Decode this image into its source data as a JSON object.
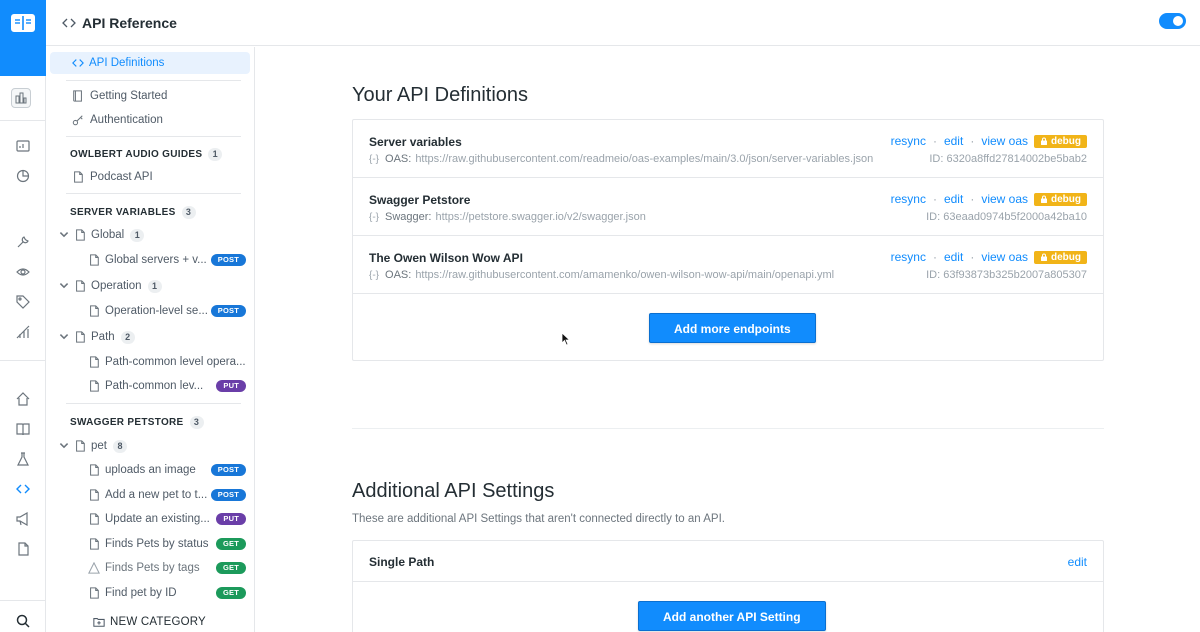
{
  "header": {
    "title": "API Reference"
  },
  "sidebar": {
    "active_item": "API Definitions",
    "top_items": [
      "Getting Started",
      "Authentication"
    ],
    "sections": [
      {
        "title": "OWLBERT AUDIO GUIDES",
        "count": "1",
        "items": [
          {
            "label": "Podcast API"
          }
        ]
      },
      {
        "title": "SERVER VARIABLES",
        "count": "3",
        "groups": [
          {
            "label": "Global",
            "count": "1",
            "pages": [
              {
                "label": "Global servers + v...",
                "method": "POST"
              }
            ]
          },
          {
            "label": "Operation",
            "count": "1",
            "pages": [
              {
                "label": "Operation-level se...",
                "method": "POST"
              }
            ]
          },
          {
            "label": "Path",
            "count": "2",
            "pages": [
              {
                "label": "Path-common level opera...",
                "method": ""
              },
              {
                "label": "Path-common lev...",
                "method": "PUT"
              }
            ]
          }
        ]
      },
      {
        "title": "SWAGGER PETSTORE",
        "count": "3",
        "groups": [
          {
            "label": "pet",
            "count": "8",
            "pages": [
              {
                "label": "uploads an image",
                "method": "POST"
              },
              {
                "label": "Add a new pet to t...",
                "method": "POST"
              },
              {
                "label": "Update an existing...",
                "method": "PUT"
              },
              {
                "label": "Finds Pets by status",
                "method": "GET"
              },
              {
                "label": "Finds Pets by tags",
                "method": "GET"
              },
              {
                "label": "Find pet by ID",
                "method": "GET"
              }
            ]
          }
        ]
      }
    ],
    "new_category": "NEW CATEGORY"
  },
  "main": {
    "definitions_title": "Your API Definitions",
    "apis": [
      {
        "name": "Server variables",
        "source_label": "OAS:",
        "url": "https://raw.githubusercontent.com/readmeio/oas-examples/main/3.0/json/server-variables.json",
        "id": "ID: 6320a8ffd27814002be5bab2"
      },
      {
        "name": "Swagger Petstore",
        "source_label": "Swagger:",
        "url": "https://petstore.swagger.io/v2/swagger.json",
        "id": "ID: 63eaad0974b5f2000a42ba10"
      },
      {
        "name": "The Owen Wilson Wow API",
        "source_label": "OAS:",
        "url": "https://raw.githubusercontent.com/amamenko/owen-wilson-wow-api/main/openapi.yml",
        "id": "ID: 63f93873b325b2007a805307"
      }
    ],
    "actions": {
      "resync": "resync",
      "edit": "edit",
      "view_oas": "view oas",
      "debug": "debug",
      "brace": "{-}"
    },
    "add_endpoints": "Add more endpoints",
    "settings_title": "Additional API Settings",
    "settings_subtitle": "These are additional API Settings that aren't connected directly to an API.",
    "settings": [
      {
        "name": "Single Path",
        "action": "edit"
      }
    ],
    "add_setting": "Add another API Setting"
  },
  "colors": {
    "accent": "#118cfd",
    "post": "#1877d8",
    "put": "#6a3ea8",
    "get": "#1c9a5b",
    "debug": "#f1b418"
  }
}
